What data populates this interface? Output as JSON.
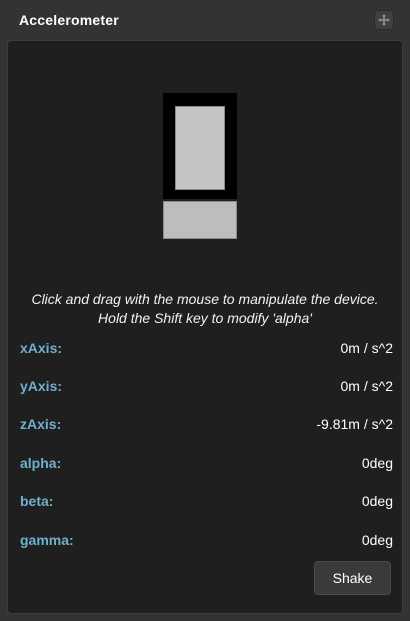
{
  "panel": {
    "title": "Accelerometer",
    "move_icon": "move-icon"
  },
  "device": {
    "instruction_line1": "Click and drag with the mouse to manipulate the device.",
    "instruction_line2": "Hold the Shift key to modify 'alpha'"
  },
  "readings": [
    {
      "label": "xAxis:",
      "value": "0m / s^2"
    },
    {
      "label": "yAxis:",
      "value": "0m / s^2"
    },
    {
      "label": "zAxis:",
      "value": "-9.81m / s^2"
    },
    {
      "label": "alpha:",
      "value": "0deg"
    },
    {
      "label": "beta:",
      "value": "0deg"
    },
    {
      "label": "gamma:",
      "value": "0deg"
    }
  ],
  "actions": {
    "shake_label": "Shake"
  },
  "colors": {
    "label": "#6fb0cc",
    "background": "#1f1f1f",
    "titlebar": "#333333"
  }
}
